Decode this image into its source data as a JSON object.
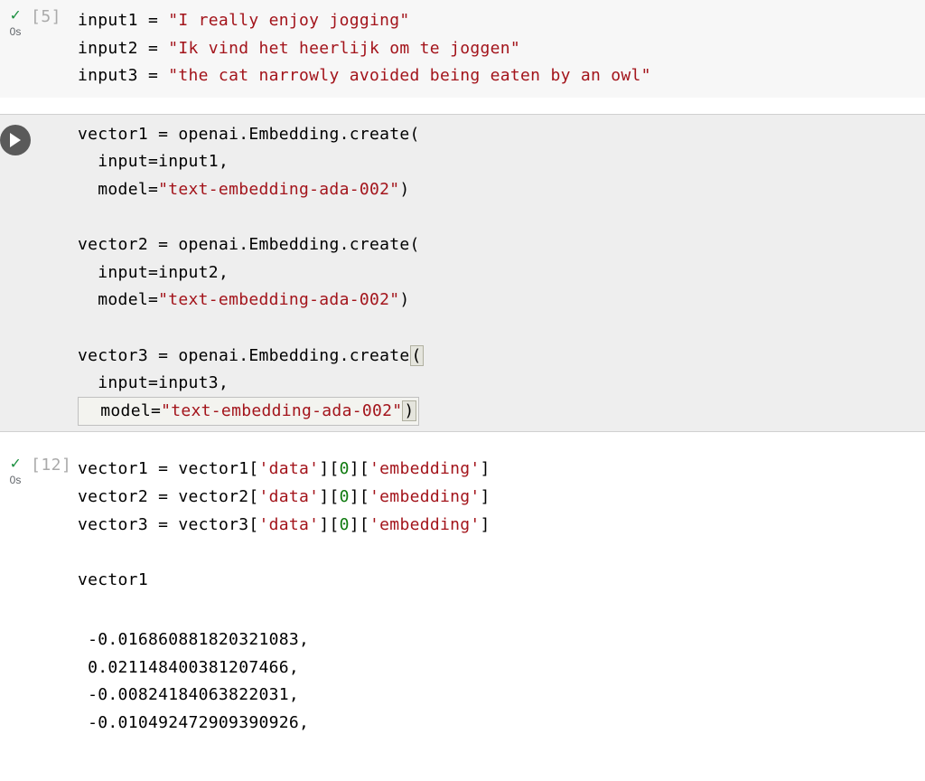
{
  "cells": [
    {
      "exec_count": "[5]",
      "status": "done",
      "time": "0s",
      "lines": [
        {
          "var": "input1",
          "str": "\"I really enjoy jogging\""
        },
        {
          "var": "input2",
          "str": "\"Ik vind het heerlijk om te joggen\""
        },
        {
          "var": "input3",
          "str": "\"the cat narrowly avoided being eaten by an owl\""
        }
      ]
    },
    {
      "status": "running",
      "code": {
        "blocks": [
          {
            "var": "vector1",
            "call_prefix": "openai.Embedding.create",
            "open": "(",
            "args_input": "input1",
            "model_str": "\"text-embedding-ada-002\"",
            "close": ")"
          },
          {
            "var": "vector2",
            "call_prefix": "openai.Embedding.create",
            "open": "(",
            "args_input": "input2",
            "model_str": "\"text-embedding-ada-002\"",
            "close": ")"
          },
          {
            "var": "vector3",
            "call_prefix": "openai.Embedding.create",
            "open_hl": "(",
            "args_input": "input3",
            "model_str": "\"text-embedding-ada-002\"",
            "close_hl": ")",
            "boxed_last": true
          }
        ]
      }
    },
    {
      "exec_count": "[12]",
      "status": "done",
      "time": "0s",
      "lines": [
        {
          "var": "vector1",
          "rhs_var": "vector1",
          "key1": "'data'",
          "idx": "0",
          "key2": "'embedding'"
        },
        {
          "var": "vector2",
          "rhs_var": "vector2",
          "key1": "'data'",
          "idx": "0",
          "key2": "'embedding'"
        },
        {
          "var": "vector3",
          "rhs_var": "vector3",
          "key1": "'data'",
          "idx": "0",
          "key2": "'embedding'"
        }
      ],
      "trailing": "vector1",
      "output": [
        "-0.016860881820321083,",
        "0.021148400381207466,",
        "-0.00824184063822031,",
        "-0.010492472909390926,"
      ]
    }
  ],
  "strings": {
    "model_kw": "model=",
    "input_kw": "input=",
    "equals": " = ",
    "comma": ","
  }
}
